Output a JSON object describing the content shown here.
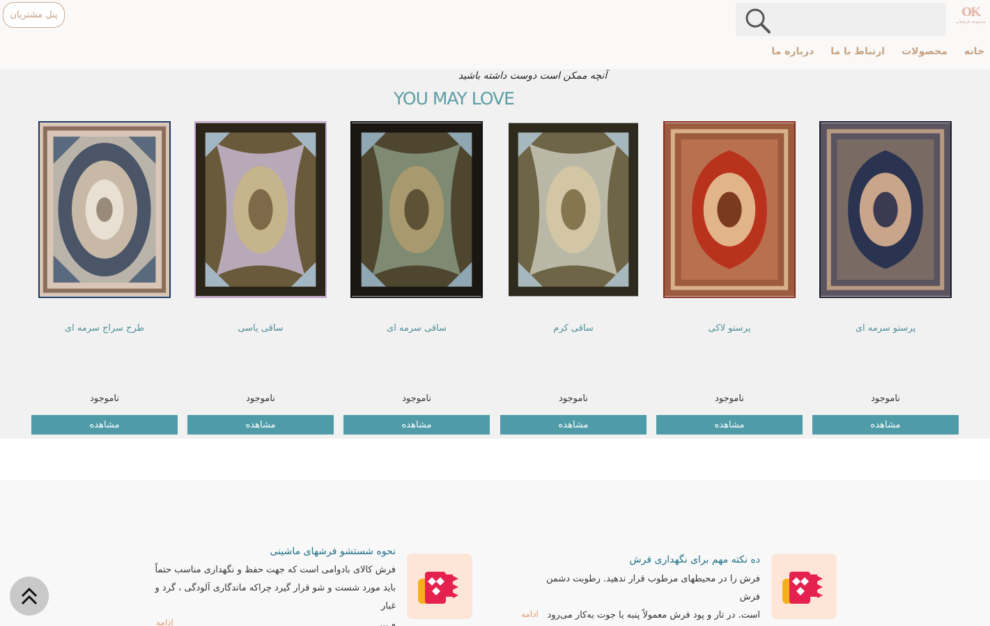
{
  "header": {
    "panel_button": "پنل مشتریان",
    "logo_text": "OK",
    "logo_sub": "مجموعه فرشتاپ",
    "search_placeholder": ""
  },
  "nav": {
    "items": [
      "خانه",
      "محصولات",
      "ارتباط با ما",
      "درباره ما"
    ]
  },
  "products": {
    "tagline": "آنچه ممکن است دوست داشته باشید",
    "title": "YOU MAY LOVE",
    "cards": [
      {
        "name": "طرح سراج سرمه ای",
        "stock": "ناموجود",
        "button": "مشاهده"
      },
      {
        "name": "ساقی یاسی",
        "stock": "ناموجود",
        "button": "مشاهده"
      },
      {
        "name": "ساقی سرمه ای",
        "stock": "ناموجود",
        "button": "مشاهده"
      },
      {
        "name": "ساقی کرم",
        "stock": "ناموجود",
        "button": "مشاهده"
      },
      {
        "name": "پرستو لاکی",
        "stock": "ناموجود",
        "button": "مشاهده"
      },
      {
        "name": "پرستو سرمه ای",
        "stock": "ناموجود",
        "button": "مشاهده"
      }
    ]
  },
  "blog": {
    "posts": [
      {
        "title": "ده نکته مهم برای نگهداری فرش",
        "lines": [
          "فرش را در محیطهای مرطوب قرار ندهید. رطوبت دشمن فرش",
          "است. در تار و پود فرش معمولاً پنبه یا جوت به‌کار می‌رود"
        ],
        "more": "ادامه"
      },
      {
        "title": "نحوه شستشو فرشهای ماشینی",
        "lines": [
          "فرش کالای بادوامی است که جهت حفظ و نگهداری مناسب حتماً",
          "باید مورد شست و شو قرار گیرد چراکه ماندگاری آلودگی ، گرد و غبار",
          "و ..."
        ],
        "more": "ادامه"
      }
    ]
  },
  "icons": {
    "search": "search-icon",
    "scroll_top": "double-chevron-up-icon",
    "blog_thumb": "carpet-logo-icon"
  }
}
